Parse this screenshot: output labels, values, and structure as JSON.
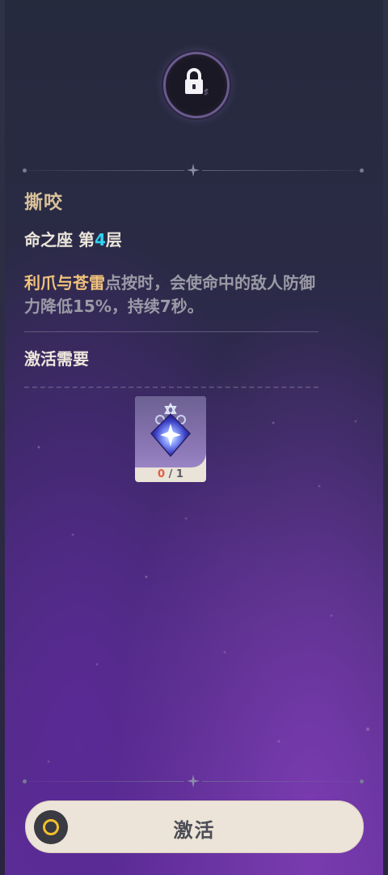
{
  "constellation": {
    "name": "撕咬",
    "level_prefix": "命之座 第",
    "level_number": "4",
    "level_suffix": "层",
    "description_highlight": "利爪与苍雷",
    "description_rest": "点按时，会使命中的敌人防御力降低15%，持续7秒。"
  },
  "requirements": {
    "label": "激活需要",
    "items": [
      {
        "icon": "constellation-stella-icon",
        "have": "0",
        "need": "/ 1"
      }
    ]
  },
  "actions": {
    "activate_label": "激活"
  },
  "icons": {
    "lock": "lock-icon",
    "button": "ring-icon"
  },
  "colors": {
    "title": "#d9c29a",
    "highlight": "#f1c27a",
    "level_number": "#2fd3ee",
    "count_have": "#e25d3f",
    "button_bg": "#ece4d8"
  }
}
